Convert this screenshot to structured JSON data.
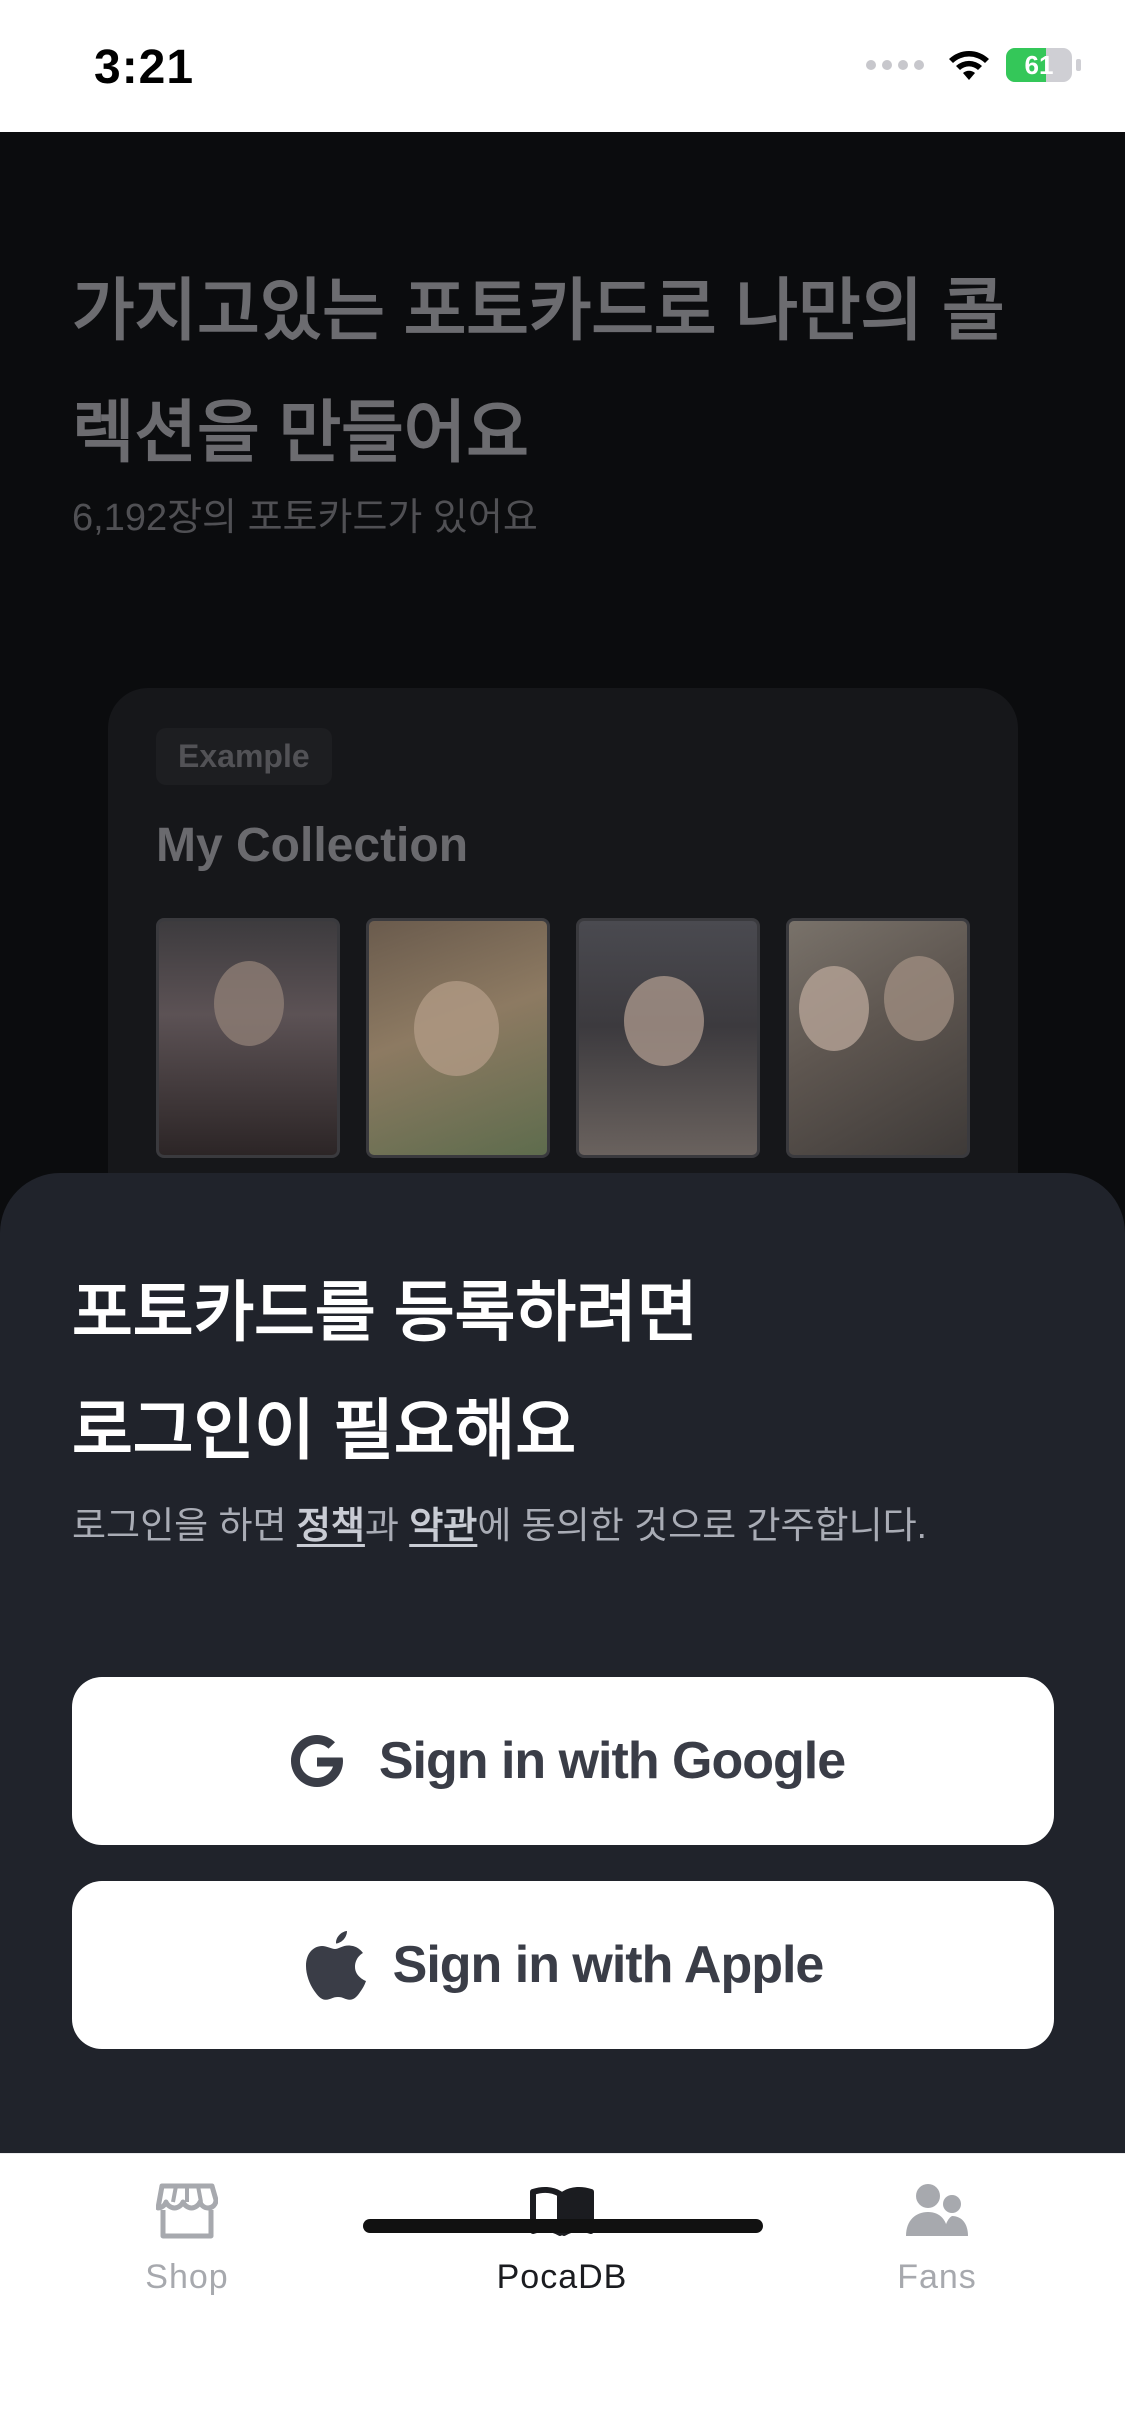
{
  "status_bar": {
    "time": "3:21",
    "battery_level": "61",
    "battery_fraction": 0.61
  },
  "background": {
    "title": "가지고있는 포토카드로 나만의 콜렉션을 만들어요",
    "subtitle": "6,192장의 포토카드가 있어요",
    "example_card": {
      "badge": "Example",
      "title": "My Collection"
    }
  },
  "sheet": {
    "title_line1": "포토카드를 등록하려면",
    "title_line2": "로그인이 필요해요",
    "note_prefix": "로그인을 하면 ",
    "note_policy": "정책",
    "note_and": "과 ",
    "note_terms": "약관",
    "note_suffix": "에 동의한 것으로 간주합니다."
  },
  "buttons": {
    "google_label": "Sign in with Google",
    "apple_label": "Sign in with Apple"
  },
  "tab_bar": {
    "tabs": [
      {
        "label": "Shop",
        "icon": "store-icon"
      },
      {
        "label": "PocaDB",
        "icon": "book-icon",
        "active": true
      },
      {
        "label": "Fans",
        "icon": "users-icon"
      }
    ]
  },
  "colors": {
    "sheet_bg": "#20232b",
    "battery_green": "#34c759",
    "active_tab": "#1b1c20",
    "inactive_tab": "#a7a9ae"
  }
}
